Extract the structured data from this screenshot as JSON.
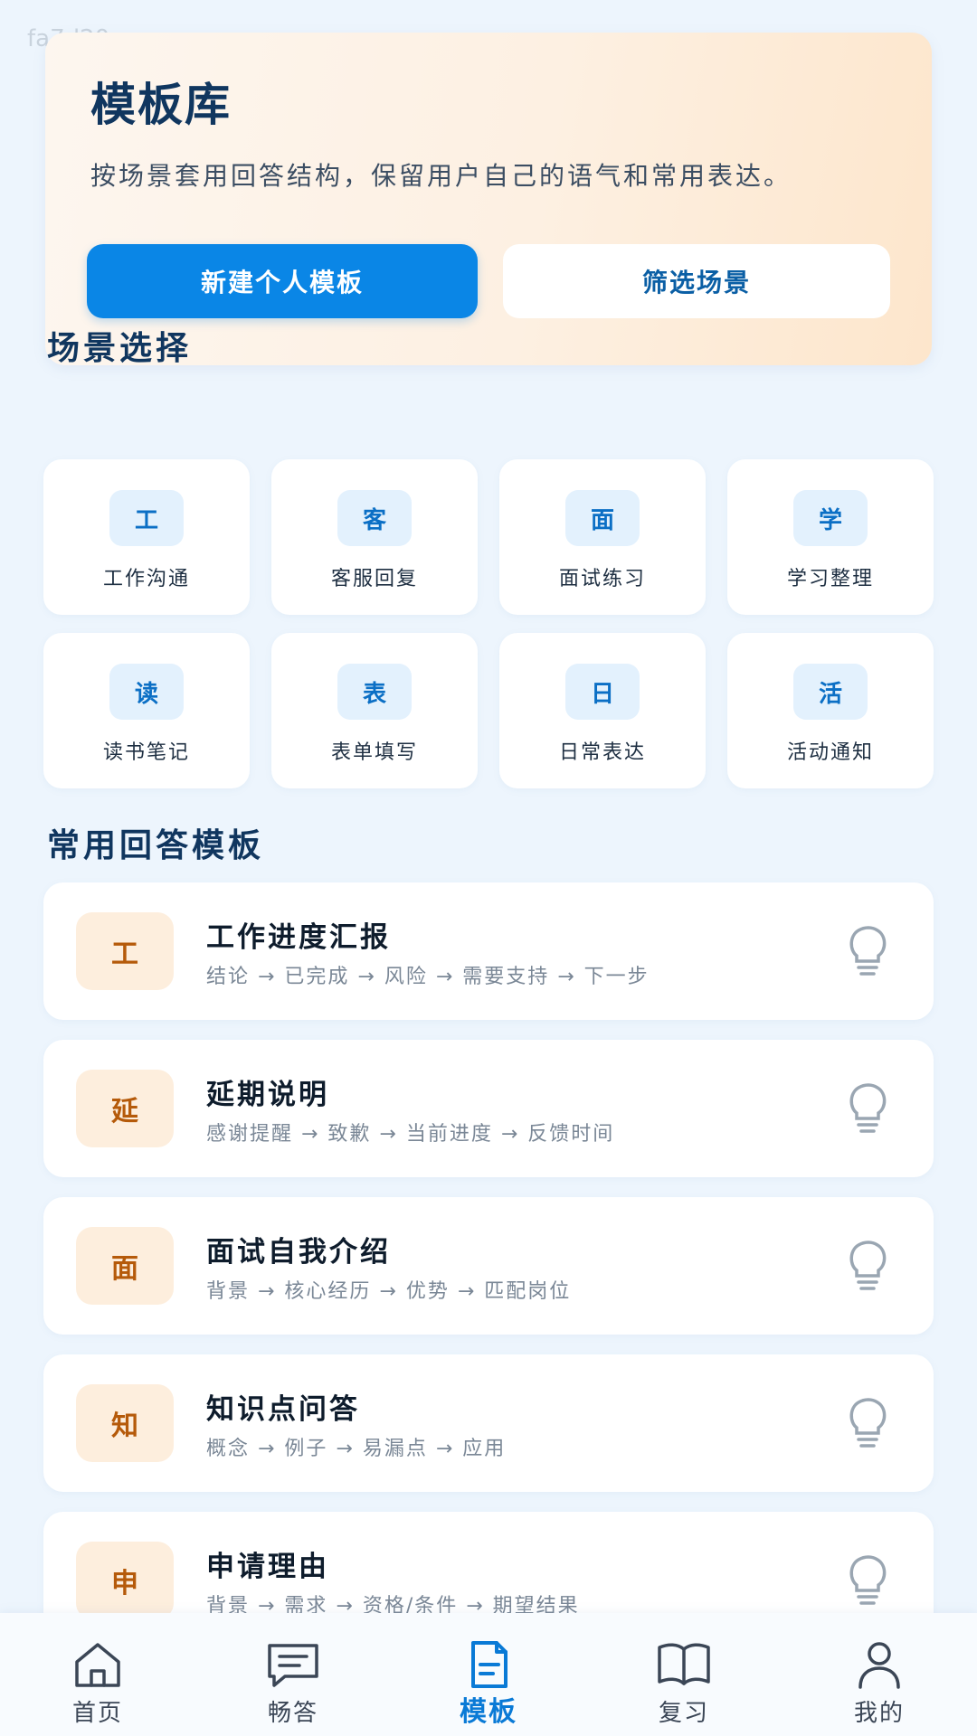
{
  "watermark": "fa7d20",
  "hero": {
    "title": "模板库",
    "description": "按场景套用回答结构，保留用户自己的语气和常用表达。",
    "primary_button": "新建个人模板",
    "secondary_button": "筛选场景"
  },
  "scenes": {
    "title": "场景选择",
    "items": [
      {
        "icon_char": "工",
        "label": "工作沟通"
      },
      {
        "icon_char": "客",
        "label": "客服回复"
      },
      {
        "icon_char": "面",
        "label": "面试练习"
      },
      {
        "icon_char": "学",
        "label": "学习整理"
      },
      {
        "icon_char": "读",
        "label": "读书笔记"
      },
      {
        "icon_char": "表",
        "label": "表单填写"
      },
      {
        "icon_char": "日",
        "label": "日常表达"
      },
      {
        "icon_char": "活",
        "label": "活动通知"
      }
    ]
  },
  "templates": {
    "title": "常用回答模板",
    "items": [
      {
        "badge": "工",
        "name": "工作进度汇报",
        "flow": "结论 → 已完成 → 风险 → 需要支持 → 下一步",
        "icon": "lightbulb-icon"
      },
      {
        "badge": "延",
        "name": "延期说明",
        "flow": "感谢提醒 → 致歉 → 当前进度 → 反馈时间",
        "icon": "lightbulb-icon"
      },
      {
        "badge": "面",
        "name": "面试自我介绍",
        "flow": "背景 → 核心经历 → 优势 → 匹配岗位",
        "icon": "lightbulb-icon"
      },
      {
        "badge": "知",
        "name": "知识点问答",
        "flow": "概念 → 例子 → 易漏点 → 应用",
        "icon": "lightbulb-icon"
      },
      {
        "badge": "申",
        "name": "申请理由",
        "flow": "背景 → 需求 → 资格/条件 → 期望结果",
        "icon": "lightbulb-icon"
      }
    ]
  },
  "tabbar": {
    "items": [
      {
        "label": "首页",
        "icon": "home-icon"
      },
      {
        "label": "畅答",
        "icon": "chat-icon"
      },
      {
        "label": "模板",
        "icon": "document-icon"
      },
      {
        "label": "复习",
        "icon": "book-icon"
      },
      {
        "label": "我的",
        "icon": "user-icon"
      }
    ],
    "active_index": 2
  },
  "colors": {
    "accent": "#0a86e6",
    "badge_bg": "#fdeedd",
    "badge_text": "#b55a0a",
    "scene_icon_bg": "#e3f1fd"
  }
}
